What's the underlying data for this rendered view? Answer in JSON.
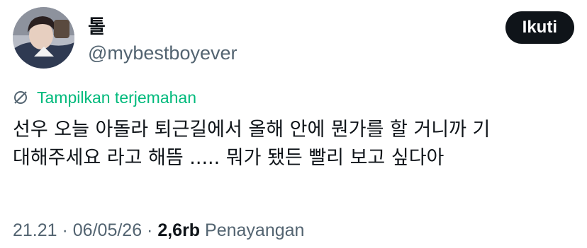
{
  "user": {
    "display_name": "톨",
    "handle": "@mybestboyever",
    "avatar_icon": "profile-photo"
  },
  "follow_button": {
    "label": "Ikuti"
  },
  "translate": {
    "label": "Tampilkan terjemahan",
    "icon": "globe-translate-icon",
    "color": "#00ba7c"
  },
  "tweet": {
    "lines": [
      "선우 오늘 아돌라 퇴근길에서 올해 안에 뭔가를 할 거니까 기",
      "대해주세요 라고 해뜸 ..... 뭐가 됐든 빨리 보고 싶다아"
    ]
  },
  "meta": {
    "time": "21.21",
    "sep1": " · ",
    "date": "06/05/26",
    "sep2": " · ",
    "views_count": "2,6rb",
    "views_label": " Penayangan"
  },
  "colors": {
    "text": "#0f1419",
    "secondary": "#536471",
    "button_bg": "#0f1419"
  }
}
